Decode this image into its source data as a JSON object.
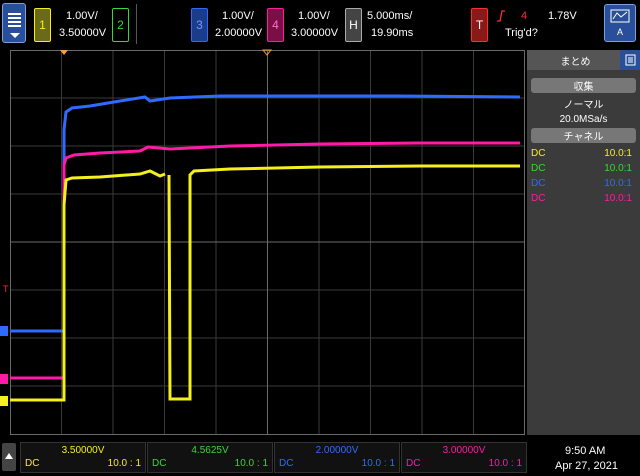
{
  "colors": {
    "ch1": "#f5ef1e",
    "ch2": "#3bd63b",
    "ch3": "#2f6bff",
    "ch4": "#ff1aa8",
    "trig": "#ff2d2d"
  },
  "topbar": {
    "ch1": {
      "num": "1",
      "scale": "1.00V/",
      "offset": "3.50000V"
    },
    "ch2": {
      "num": "2"
    },
    "ch3": {
      "num": "3",
      "scale": "1.00V/",
      "offset": "2.00000V"
    },
    "ch4": {
      "num": "4",
      "scale": "1.00V/",
      "offset": "3.00000V"
    },
    "horiz": {
      "label": "H",
      "scale": "5.000ms/",
      "pos": "19.90ms"
    },
    "trigger": {
      "label": "T",
      "source": "4",
      "level": "1.78V",
      "status": "Trig'd?"
    }
  },
  "right_panel": {
    "tab_label": "まとめ",
    "acq_header": "収集",
    "acq_mode": "ノーマル",
    "sample_rate": "20.0MSa/s",
    "channel_header": "チャネル",
    "channels": [
      {
        "coupling": "DC",
        "probe": "10.0:1"
      },
      {
        "coupling": "DC",
        "probe": "10.0:1"
      },
      {
        "coupling": "DC",
        "probe": "10.0:1"
      },
      {
        "coupling": "DC",
        "probe": "10.0:1"
      }
    ]
  },
  "bottombar": {
    "cells": [
      {
        "value": "3.50000V",
        "coupling": "DC",
        "probe": "10.0 : 1"
      },
      {
        "value": "4.5625V",
        "coupling": "DC",
        "probe": "10.0 : 1"
      },
      {
        "value": "2.00000V",
        "coupling": "DC",
        "probe": "10.0 : 1"
      },
      {
        "value": "3.00000V",
        "coupling": "DC",
        "probe": "10.0 : 1"
      }
    ],
    "time": "9:50 AM",
    "date": "Apr 27, 2021"
  }
}
